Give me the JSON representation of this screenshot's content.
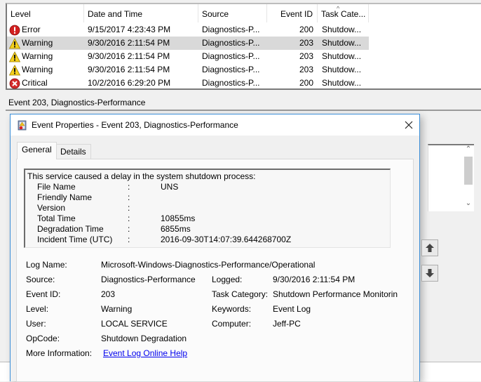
{
  "event_list": {
    "columns": [
      "Level",
      "Date and Time",
      "Source",
      "Event ID",
      "Task Cate..."
    ],
    "sort_icon": "sort-ascending-caret",
    "rows": [
      {
        "level": "Error",
        "icon": "error-icon",
        "datetime": "9/15/2017 4:23:43 PM",
        "source": "Diagnostics-P...",
        "event_id": "200",
        "task": "Shutdow..."
      },
      {
        "level": "Warning",
        "icon": "warning-icon",
        "datetime": "9/30/2016 2:11:54 PM",
        "source": "Diagnostics-P...",
        "event_id": "203",
        "task": "Shutdow...",
        "selected": true
      },
      {
        "level": "Warning",
        "icon": "warning-icon",
        "datetime": "9/30/2016 2:11:54 PM",
        "source": "Diagnostics-P...",
        "event_id": "203",
        "task": "Shutdow..."
      },
      {
        "level": "Warning",
        "icon": "warning-icon",
        "datetime": "9/30/2016 2:11:54 PM",
        "source": "Diagnostics-P...",
        "event_id": "203",
        "task": "Shutdow..."
      },
      {
        "level": "Critical",
        "icon": "critical-icon",
        "datetime": "10/2/2016 6:29:20 PM",
        "source": "Diagnostics-P...",
        "event_id": "200",
        "task": "Shutdow..."
      }
    ]
  },
  "event_strip": {
    "title": "Event 203, Diagnostics-Performance"
  },
  "dialog": {
    "title": "Event Properties - Event 203, Diagnostics-Performance",
    "close_label": "✕",
    "tabs": [
      {
        "label": "General",
        "active": true
      },
      {
        "label": "Details",
        "active": false
      }
    ],
    "description": {
      "heading": "This service caused a delay in the system shutdown process:",
      "items": [
        {
          "key": "File Name",
          "value": "UNS"
        },
        {
          "key": "Friendly Name",
          "value": ""
        },
        {
          "key": "Version",
          "value": ""
        },
        {
          "key": "Total Time",
          "value": "10855ms"
        },
        {
          "key": "Degradation Time",
          "value": "6855ms"
        },
        {
          "key": "Incident Time (UTC)",
          "value": "2016-09-30T14:07:39.644268700Z"
        }
      ]
    },
    "fields": {
      "log_name_label": "Log Name:",
      "log_name": "Microsoft-Windows-Diagnostics-Performance/Operational",
      "source_label": "Source:",
      "source": "Diagnostics-Performance",
      "event_id_label": "Event ID:",
      "event_id": "203",
      "level_label": "Level:",
      "level": "Warning",
      "user_label": "User:",
      "user": "LOCAL SERVICE",
      "opcode_label": "OpCode:",
      "opcode": "Shutdown Degradation",
      "more_info_label": "More Information:",
      "more_info_link": "Event Log Online Help",
      "logged_label": "Logged:",
      "logged": "9/30/2016 2:11:54 PM",
      "task_category_label": "Task Category:",
      "task_category": "Shutdown Performance Monitorin",
      "keywords_label": "Keywords:",
      "keywords": "Event Log",
      "computer_label": "Computer:",
      "computer": "Jeff-PC"
    },
    "nav": {
      "previous": "previous-event-arrow-up",
      "next": "next-event-arrow-down"
    }
  },
  "colors": {
    "dialog_border": "#3c8fd8",
    "link": "#0000ee",
    "selected_row": "#d9d9d9"
  }
}
